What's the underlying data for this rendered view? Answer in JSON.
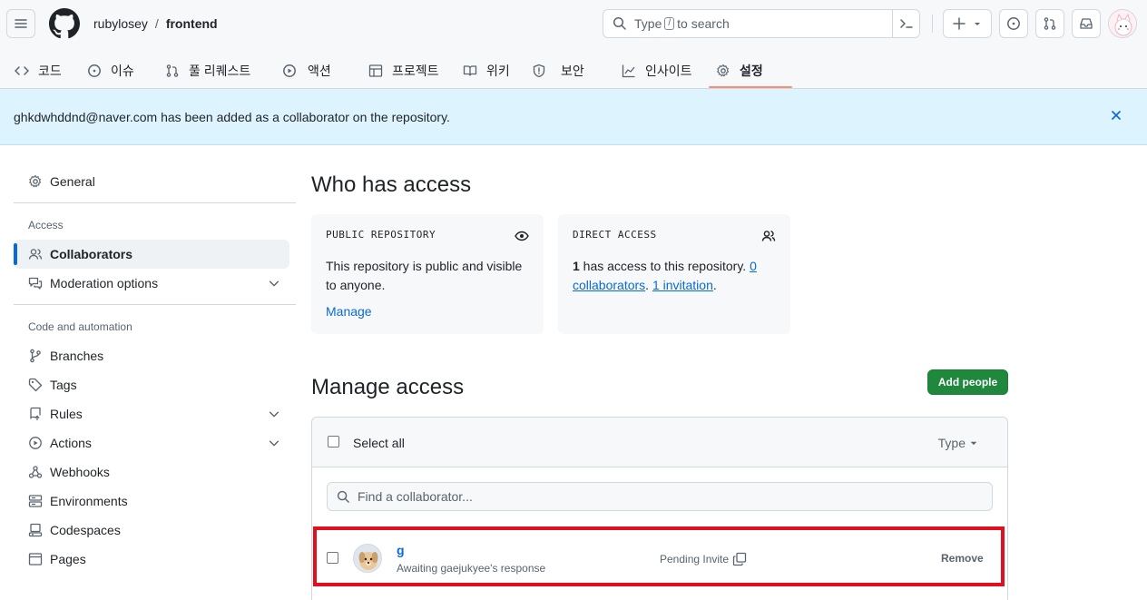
{
  "header": {
    "owner": "rubylosey",
    "separator": "/",
    "repo": "frontend",
    "search": {
      "prefix": "Type",
      "key": "/",
      "suffix": "to search"
    }
  },
  "nav": [
    {
      "label": "코드",
      "icon": "code-icon"
    },
    {
      "label": "이슈",
      "icon": "issue-icon"
    },
    {
      "label": "풀 리퀘스트",
      "icon": "pull-request-icon"
    },
    {
      "label": "액션",
      "icon": "play-icon"
    },
    {
      "label": "프로젝트",
      "icon": "table-icon"
    },
    {
      "label": "위키",
      "icon": "book-icon"
    },
    {
      "label": "보안",
      "icon": "shield-icon"
    },
    {
      "label": "인사이트",
      "icon": "graph-icon"
    },
    {
      "label": "설정",
      "icon": "gear-icon",
      "selected": true
    }
  ],
  "flash": {
    "message": "ghkdwhddnd@naver.com has been added as a collaborator on the repository."
  },
  "sidebar": {
    "general": "General",
    "access_heading": "Access",
    "collaborators": "Collaborators",
    "moderation": "Moderation options",
    "code_heading": "Code and automation",
    "branches": "Branches",
    "tags": "Tags",
    "rules": "Rules",
    "actions": "Actions",
    "webhooks": "Webhooks",
    "environments": "Environments",
    "codespaces": "Codespaces",
    "pages": "Pages"
  },
  "main": {
    "who_title": "Who has access",
    "public_box": {
      "label": "PUBLIC REPOSITORY",
      "text": "This repository is public and visible to anyone.",
      "manage": "Manage"
    },
    "direct_box": {
      "label": "DIRECT ACCESS",
      "count": "1",
      "text_a": " has access to this repository. ",
      "collab_link": "0 collaborators",
      "text_b": ". ",
      "invite_link": "1 invitation",
      "text_c": "."
    },
    "manage_title": "Manage access",
    "add_people": "Add people",
    "select_all": "Select all",
    "type_filter": "Type",
    "find_placeholder": "Find a collaborator...",
    "row": {
      "name": "g",
      "subtitle": "Awaiting gaejukyee's response",
      "status": "Pending Invite",
      "remove": "Remove"
    }
  }
}
